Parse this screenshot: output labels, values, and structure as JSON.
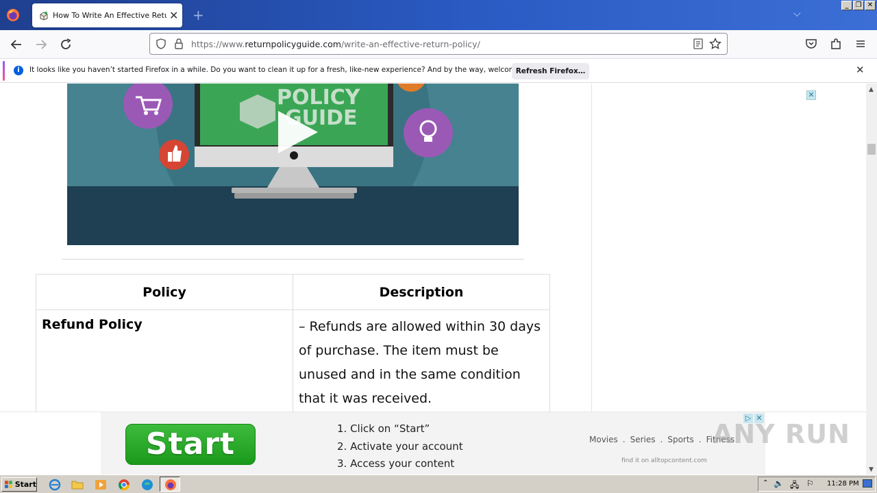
{
  "browser": {
    "tab_title": "How To Write An Effective Return Policy",
    "url_prefix": "https://www.",
    "url_host": "returnpolicyguide.com",
    "url_path": "/write-an-effective-return-policy/"
  },
  "notification": {
    "text": "It looks like you haven’t started Firefox in a while. Do you want to clean it up for a fresh, like-new experience? And by the way, welcome back!",
    "button_label": "Refresh Firefox…"
  },
  "table": {
    "headers": [
      "Policy",
      "Description"
    ],
    "rows": [
      {
        "policy": "Refund Policy",
        "description": "– Refunds are allowed within 30 days of purchase. The item must be unused and in the same condition that it was received."
      }
    ]
  },
  "video": {
    "logo_line1": "POLICY",
    "logo_line2": "GUIDE"
  },
  "ad": {
    "start_label": "Start",
    "steps": [
      "1. Click on “Start”",
      "2. Activate your account",
      "3. Access your content"
    ],
    "categories": [
      "Movies",
      "Series",
      "Sports",
      "Fitness"
    ],
    "find_text": "find it on alltopcontent.com"
  },
  "watermark": "ANY RUN",
  "taskbar": {
    "start_label": "Start",
    "clock": "11:28 PM"
  }
}
